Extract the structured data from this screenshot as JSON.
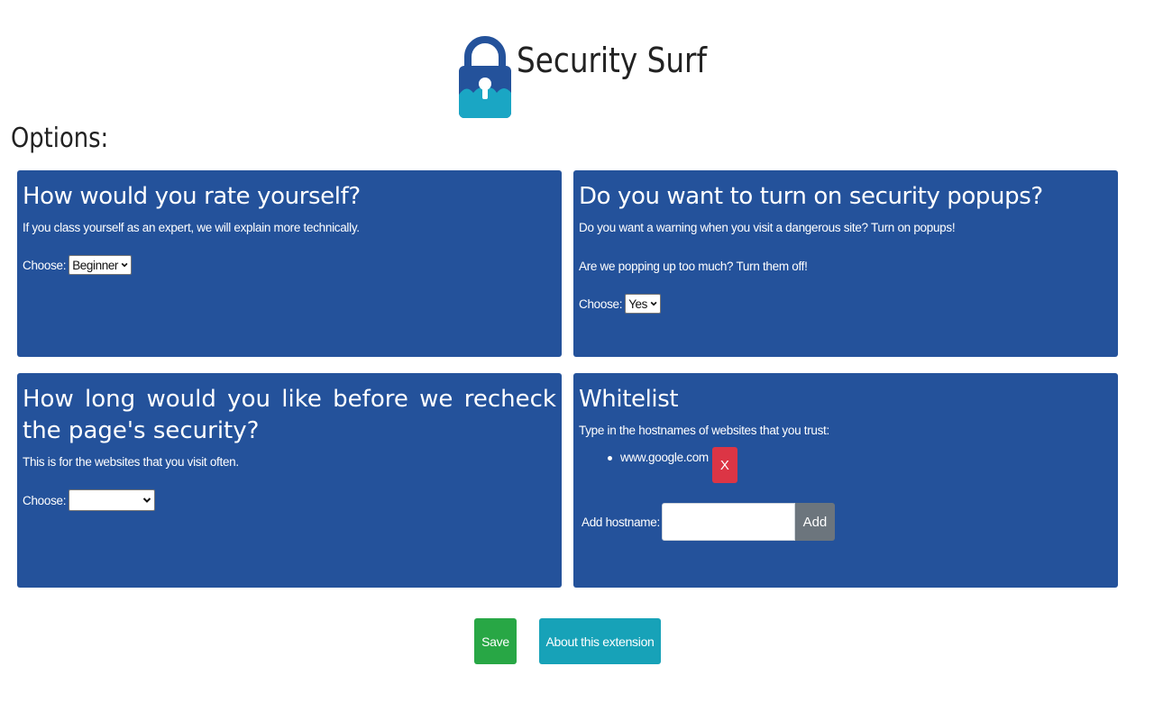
{
  "header": {
    "app_title": "Security Surf",
    "logo_icon": "padlock-icon",
    "colors": {
      "lock_body_top": "#24529b",
      "lock_body_bottom": "#1aa6c4"
    }
  },
  "options_heading": "Options:",
  "cards": {
    "rating": {
      "title": "How would you rate yourself?",
      "description": "If you class yourself as an expert, we will explain more technically.",
      "choose_label": "Choose:",
      "selected": "Beginner"
    },
    "popups": {
      "title": "Do you want to turn on security popups?",
      "description_1": "Do you want a warning when you visit a dangerous site? Turn on popups!",
      "description_2": "Are we popping up too much? Turn them off!",
      "choose_label": "Choose:",
      "selected": "Yes"
    },
    "recheck": {
      "title": "How long would you like before we recheck the page's security?",
      "description": "This is for the websites that you visit often.",
      "choose_label": "Choose:",
      "selected": ""
    },
    "whitelist": {
      "title": "Whitelist",
      "description": "Type in the hostnames of websites that you trust:",
      "items": [
        {
          "hostname": "www.google.com",
          "remove_label": "X"
        }
      ],
      "add_label": "Add hostname:",
      "input_value": "",
      "add_button_label": "Add"
    }
  },
  "footer": {
    "save_label": "Save",
    "about_label": "About this extension"
  },
  "colors": {
    "card_background": "#24529b",
    "save_button": "#28a745",
    "about_button": "#17a2b8",
    "remove_button": "#dc3545",
    "add_button": "#6c757d"
  }
}
